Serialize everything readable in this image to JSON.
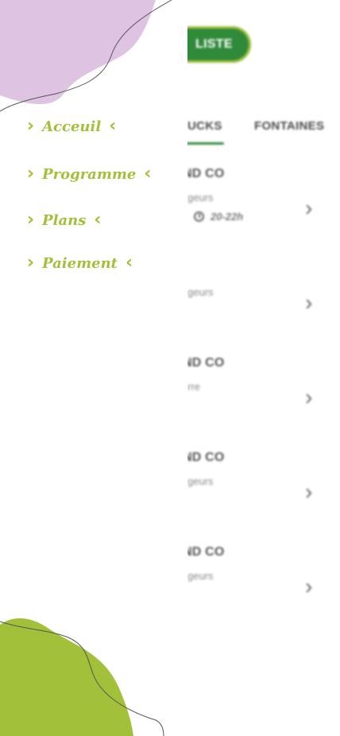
{
  "background": {
    "header": {
      "list_button": "LISTE"
    },
    "tabs": [
      {
        "label": "UCKS"
      },
      {
        "label": "FONTAINES"
      }
    ],
    "rows": [
      {
        "title": "ND CO",
        "subtitle": "geurs",
        "meta": "20-22h"
      },
      {
        "title": "",
        "subtitle": "geurs"
      },
      {
        "title": "ND CO",
        "subtitle": "rre"
      },
      {
        "title": "ND CO",
        "subtitle": "geurs"
      },
      {
        "title": "ND CO",
        "subtitle": "geurs"
      }
    ]
  },
  "menu": {
    "items": [
      {
        "label": "Acceuil"
      },
      {
        "label": "Programme"
      },
      {
        "label": "Plans"
      },
      {
        "label": "Paiement"
      }
    ]
  },
  "icons": {
    "chevron_right": "chevron-right-icon",
    "chevron_left": "chevron-left-icon",
    "clock": "clock-icon"
  },
  "colors": {
    "accent_green": "#a2c03a",
    "dark_green": "#2f8a3a",
    "lilac": "#dfc3e2"
  }
}
